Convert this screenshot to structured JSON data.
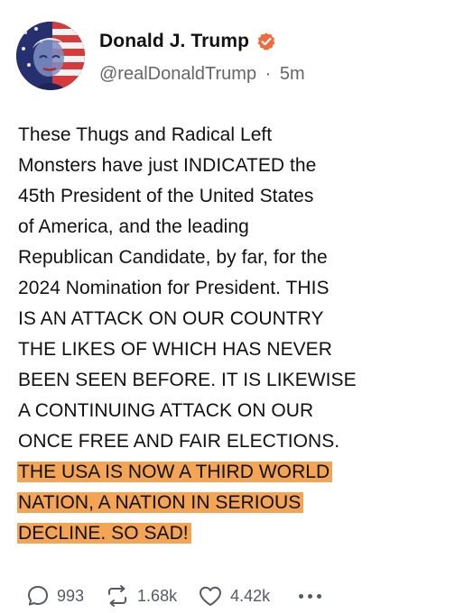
{
  "post": {
    "author": {
      "display_name": "Donald J. Trump",
      "handle": "@realDonaldTrump",
      "separator": "·",
      "time_ago": "5m",
      "verified": true,
      "verified_color": "#f26a3c"
    },
    "text_lines": [
      "These Thugs and Radical Left",
      "Monsters have just INDICATED the",
      "45th President of the United States",
      "of America, and the leading",
      "Republican Candidate, by far, for the",
      "2024 Nomination for President. THIS",
      "IS AN ATTACK ON OUR COUNTRY",
      "THE LIKES OF WHICH HAS NEVER",
      "BEEN SEEN BEFORE. IT IS LIKEWISE",
      "A CONTINUING ATTACK ON OUR",
      "ONCE FREE AND FAIR ELECTIONS."
    ],
    "highlighted_lines": [
      "THE USA IS NOW A THIRD WORLD",
      "NATION, A NATION IN SERIOUS",
      "DECLINE. SO SAD!"
    ],
    "highlight_color": "#f3a455",
    "actions": {
      "replies": "993",
      "reposts": "1.68k",
      "likes": "4.42k",
      "reply_icon": "reply-icon",
      "repost_icon": "repost-icon",
      "like_icon": "heart-icon",
      "more_icon": "more-icon"
    }
  }
}
